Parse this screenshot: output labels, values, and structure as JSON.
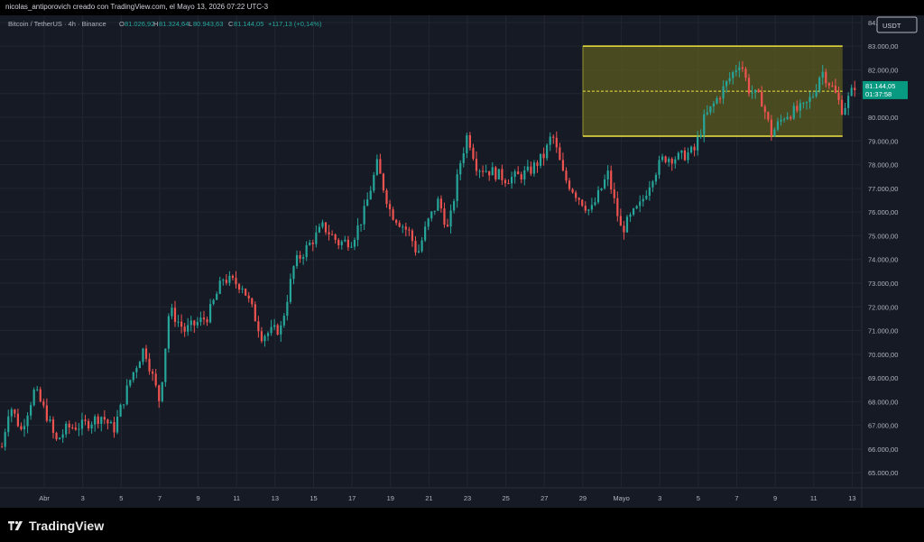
{
  "header": {
    "title": "nicolas_antiporovich creado con TradingView.com, el Mayo 13, 2026 07:22 UTC-3"
  },
  "legend": {
    "symbol": "Bitcoin / TetherUS · 4h · Binance",
    "open_label": "O",
    "open": "81.026,92",
    "high_label": "H",
    "high": "81.324,64",
    "low_label": "L",
    "low": "80.943,63",
    "close_label": "C",
    "close": "81.144,05",
    "change": "+117,13 (+0,14%)"
  },
  "currency_button": "USDT",
  "price_badge": {
    "price": "81.144,05",
    "countdown": "01:37:58"
  },
  "footer": {
    "brand": "TradingView"
  },
  "colors": {
    "background": "#161a25",
    "up": "#26a69a",
    "down": "#ef5350",
    "box_fill": "#5e5d20",
    "box_border": "#f0e442",
    "grid": "#222631",
    "text": "#b2b5be"
  },
  "chart_data": {
    "type": "candlestick",
    "series_name": "Bitcoin / TetherUS · 4h · Binance",
    "ylim": [
      64400,
      84300
    ],
    "y_ticks": [
      65000,
      66000,
      67000,
      68000,
      69000,
      70000,
      71000,
      72000,
      73000,
      74000,
      75000,
      76000,
      77000,
      78000,
      79000,
      80000,
      81000,
      82000,
      83000,
      84000
    ],
    "y_tick_labels": [
      "65.000,00",
      "66.000,00",
      "67.000,00",
      "68.000,00",
      "69.000,00",
      "70.000,00",
      "71.000,00",
      "72.000,00",
      "73.000,00",
      "74.000,00",
      "75.000,00",
      "76.000,00",
      "77.000,00",
      "78.000,00",
      "79.000,00",
      "80.000,00",
      "81.000,00",
      "82.000,00",
      "83.000,00",
      "84.000,00"
    ],
    "x_ticks": [
      {
        "label": "Abr",
        "t": 0
      },
      {
        "label": "3",
        "t": 2
      },
      {
        "label": "5",
        "t": 4
      },
      {
        "label": "7",
        "t": 6
      },
      {
        "label": "9",
        "t": 8
      },
      {
        "label": "11",
        "t": 10
      },
      {
        "label": "13",
        "t": 12
      },
      {
        "label": "15",
        "t": 14
      },
      {
        "label": "17",
        "t": 16
      },
      {
        "label": "19",
        "t": 18
      },
      {
        "label": "21",
        "t": 20
      },
      {
        "label": "23",
        "t": 22
      },
      {
        "label": "25",
        "t": 24
      },
      {
        "label": "27",
        "t": 26
      },
      {
        "label": "29",
        "t": 28
      },
      {
        "label": "Mayo",
        "t": 30
      },
      {
        "label": "3",
        "t": 32
      },
      {
        "label": "5",
        "t": 34
      },
      {
        "label": "7",
        "t": 36
      },
      {
        "label": "9",
        "t": 38
      },
      {
        "label": "11",
        "t": 40
      },
      {
        "label": "13",
        "t": 42
      }
    ],
    "x_range": [
      -2.3,
      42.45
    ],
    "candles_per_day": 6,
    "start_t": -2.2,
    "anchors": [
      [
        -2.2,
        66100
      ],
      [
        -1.8,
        67900
      ],
      [
        -1.2,
        66800
      ],
      [
        -0.5,
        68500
      ],
      [
        0.2,
        67300
      ],
      [
        0.6,
        66300
      ],
      [
        1.2,
        66900
      ],
      [
        2,
        67000
      ],
      [
        3,
        67400
      ],
      [
        3.6,
        66800
      ],
      [
        4.5,
        69000
      ],
      [
        5.2,
        70300
      ],
      [
        6,
        68000
      ],
      [
        6.5,
        71900
      ],
      [
        7.3,
        71000
      ],
      [
        8.5,
        71600
      ],
      [
        9.3,
        73200
      ],
      [
        10.3,
        72900
      ],
      [
        10.8,
        71900
      ],
      [
        11.3,
        70800
      ],
      [
        12.3,
        71100
      ],
      [
        13,
        73800
      ],
      [
        14.5,
        75400
      ],
      [
        15.3,
        74700
      ],
      [
        16,
        74800
      ],
      [
        16.6,
        75900
      ],
      [
        17.3,
        78000
      ],
      [
        18,
        76000
      ],
      [
        19,
        75100
      ],
      [
        19.4,
        74200
      ],
      [
        19.9,
        75500
      ],
      [
        20.5,
        76500
      ],
      [
        21,
        75200
      ],
      [
        21.6,
        78000
      ],
      [
        22,
        79300
      ],
      [
        22.5,
        77900
      ],
      [
        23.3,
        77700
      ],
      [
        24,
        77400
      ],
      [
        24.6,
        77500
      ],
      [
        25.2,
        77700
      ],
      [
        26,
        78400
      ],
      [
        26.4,
        79300
      ],
      [
        27,
        77500
      ],
      [
        27.6,
        76800
      ],
      [
        28.4,
        76000
      ],
      [
        29.3,
        77600
      ],
      [
        30,
        75200
      ],
      [
        30.6,
        75900
      ],
      [
        31,
        76300
      ],
      [
        31.6,
        77500
      ],
      [
        32.2,
        78300
      ],
      [
        33,
        78300
      ],
      [
        33.8,
        78600
      ],
      [
        34.3,
        79900
      ],
      [
        35,
        80800
      ],
      [
        35.6,
        81600
      ],
      [
        36.2,
        82400
      ],
      [
        36.6,
        81200
      ],
      [
        37.3,
        80700
      ],
      [
        37.8,
        79300
      ],
      [
        38.5,
        80100
      ],
      [
        39.5,
        80400
      ],
      [
        40,
        81000
      ],
      [
        40.4,
        82000
      ],
      [
        41,
        81200
      ],
      [
        41.5,
        80300
      ],
      [
        42,
        81100
      ],
      [
        42.2,
        81150
      ]
    ],
    "last_close": 81144.05,
    "range_box": {
      "t_start": 28.0,
      "t_end": 41.5,
      "top": 83000,
      "bottom": 79200,
      "midline": 81100
    }
  }
}
